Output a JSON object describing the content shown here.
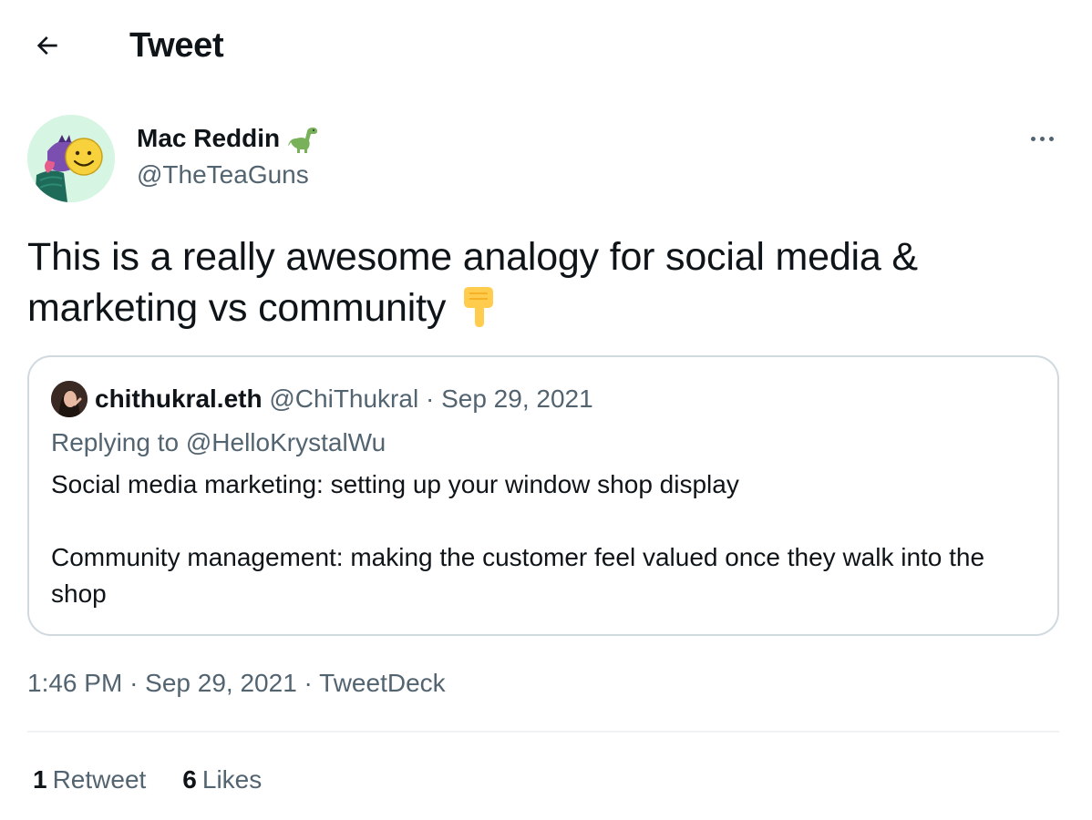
{
  "header": {
    "back_icon": "arrow-left-icon",
    "title": "Tweet"
  },
  "tweet": {
    "author": {
      "name": "Mac Reddin",
      "name_emoji_icon": "dinosaur-icon",
      "handle": "@TheTeaGuns",
      "avatar_icon": "smiley-avatar"
    },
    "more_icon": "more-dots-icon",
    "text": "This is a really awesome analogy for social media & marketing vs community",
    "text_emoji_icon": "backhand-pointing-down-icon",
    "quoted": {
      "author_name": "chithukral.eth",
      "author_handle": "@ChiThukral",
      "separator": "·",
      "date": "Sep 29, 2021",
      "replying_to": "Replying to @HelloKrystalWu",
      "body_line_1": "Social media marketing: setting up your window shop display",
      "body_line_2": "Community management: making the customer feel valued once they walk into the shop"
    },
    "timestamp": {
      "time": "1:46 PM",
      "separator": "·",
      "date": "Sep 29, 2021",
      "source": "TweetDeck"
    },
    "stats": {
      "retweets_count": "1",
      "retweets_label": "Retweet",
      "likes_count": "6",
      "likes_label": "Likes"
    }
  },
  "colors": {
    "text_primary": "#0f1419",
    "text_secondary": "#536471",
    "border": "#cfd9de",
    "divider": "#eff3f4"
  }
}
